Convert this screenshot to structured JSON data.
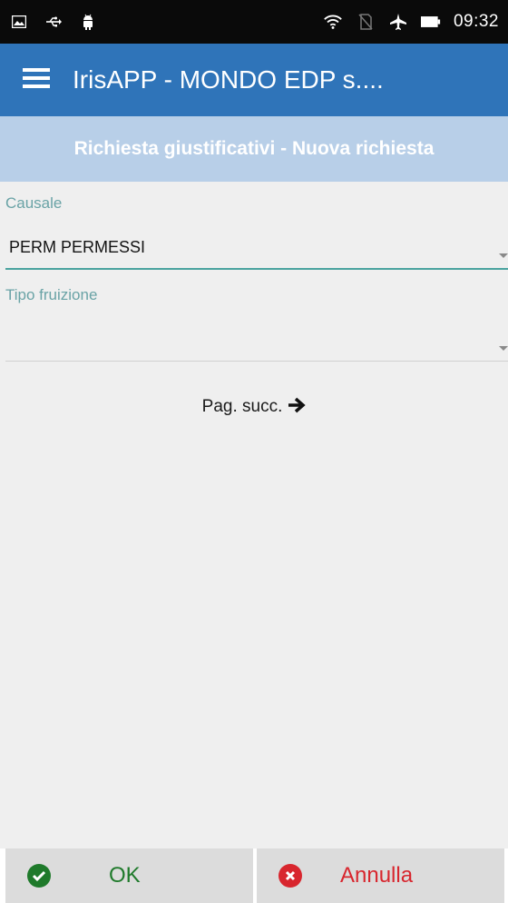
{
  "status_bar": {
    "time": "09:32",
    "left_icons": [
      "image-notification-icon",
      "usb-icon",
      "android-icon"
    ],
    "right_icons": [
      "wifi-icon",
      "no-sim-icon",
      "airplane-mode-icon",
      "battery-icon"
    ]
  },
  "app_bar": {
    "title": "IrisAPP - MONDO EDP s....",
    "menu_icon": "hamburger-menu-icon",
    "color": "#2f74b9"
  },
  "subheader": {
    "title": "Richiesta giustificativi - Nuova richiesta",
    "color": "#b8cfe8"
  },
  "form": {
    "causale": {
      "label": "Causale",
      "value": "PERM  PERMESSI"
    },
    "tipo_fruizione": {
      "label": "Tipo fruizione",
      "value": ""
    },
    "next_page": {
      "label": "Pag. succ.",
      "icon": "arrow-right-icon"
    }
  },
  "actions": {
    "ok": {
      "label": "OK",
      "icon": "check-circle-icon",
      "color": "#1f7a2b"
    },
    "cancel": {
      "label": "Annulla",
      "icon": "close-circle-icon",
      "color": "#d8262e"
    }
  },
  "colors": {
    "accent": "#4aa39f",
    "label": "#6aa3a6",
    "background": "#efefef"
  }
}
